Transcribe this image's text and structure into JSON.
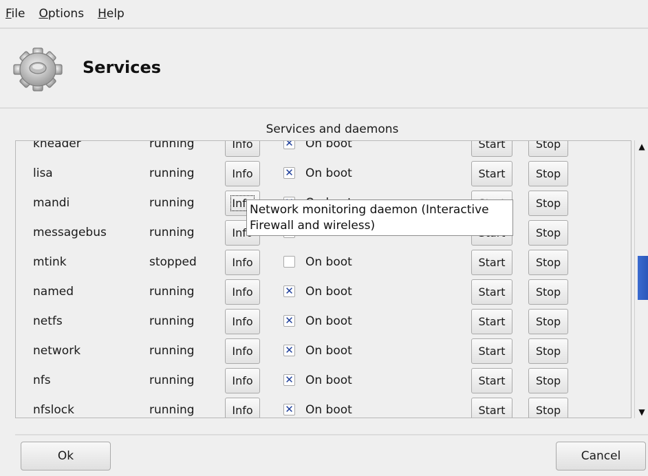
{
  "menu": {
    "file": {
      "u": "F",
      "rest": "ile"
    },
    "options": {
      "u": "O",
      "rest": "ptions"
    },
    "help": {
      "u": "H",
      "rest": "elp"
    }
  },
  "header": {
    "title": "Services",
    "icon": "gear-icon"
  },
  "group_title": "Services and daemons",
  "labels": {
    "info": "Info",
    "start": "Start",
    "stop": "Stop",
    "on_boot": "On boot"
  },
  "rows": [
    {
      "name": "kheader",
      "status": "running",
      "on_boot": true
    },
    {
      "name": "lisa",
      "status": "running",
      "on_boot": true
    },
    {
      "name": "mandi",
      "status": "running",
      "on_boot": true
    },
    {
      "name": "messagebus",
      "status": "running",
      "on_boot": true
    },
    {
      "name": "mtink",
      "status": "stopped",
      "on_boot": false
    },
    {
      "name": "named",
      "status": "running",
      "on_boot": true
    },
    {
      "name": "netfs",
      "status": "running",
      "on_boot": true
    },
    {
      "name": "network",
      "status": "running",
      "on_boot": true
    },
    {
      "name": "nfs",
      "status": "running",
      "on_boot": true
    },
    {
      "name": "nfslock",
      "status": "running",
      "on_boot": true
    }
  ],
  "tooltip": {
    "line1": "Network monitoring daemon (Interactive",
    "line2": "Firewall and wireless)"
  },
  "footer": {
    "ok": "Ok",
    "cancel": "Cancel"
  },
  "colors": {
    "accent": "#2a56b8",
    "check": "#1f3f9a"
  }
}
